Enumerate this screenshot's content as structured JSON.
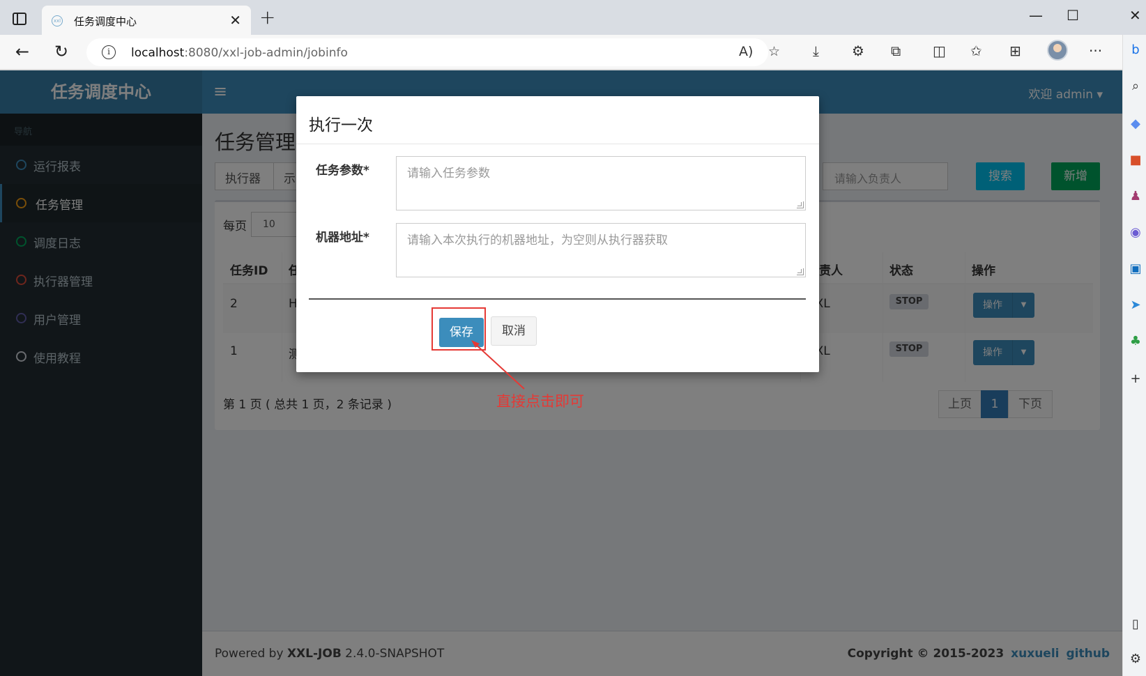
{
  "browser": {
    "tab_title": "任务调度中心",
    "tab_favicon": "xxl",
    "tab_close": "✕",
    "new_tab": "+",
    "url_host": "localhost",
    "url_rest": ":8080/xxl-job-admin/jobinfo",
    "controls": {
      "minimize": "—",
      "maximize": "☐",
      "close": "✕"
    },
    "icons": [
      "read-aloud-icon",
      "favorite-add-icon",
      "downloads-icon",
      "extension-icon",
      "extensions-icon",
      "split-screen-icon",
      "favorites-icon",
      "collections-icon",
      "profile-avatar-icon",
      "more-icon",
      "bing-icon"
    ]
  },
  "app": {
    "logo": "任务调度中心",
    "nav_header": "导航",
    "menu": [
      {
        "label": "运行报表",
        "color": "#3c8dbc"
      },
      {
        "label": "任务管理",
        "color": "#f39c12"
      },
      {
        "label": "调度日志",
        "color": "#00a65a"
      },
      {
        "label": "执行器管理",
        "color": "#dd4b39"
      },
      {
        "label": "用户管理",
        "color": "#605ca8"
      },
      {
        "label": "使用教程",
        "color": "#d2d6de"
      }
    ],
    "welcome": "欢迎 admin ▾"
  },
  "main": {
    "title": "任务管理",
    "filter_executor": "执行器",
    "filter_more": "示",
    "owner_placeholder": "请输入负责人",
    "search_label": "搜索",
    "add_label": "新增",
    "per_page_label": "每页",
    "per_page_value": "10",
    "columns": [
      "任务ID",
      "任",
      "负责人",
      "状态",
      "操作"
    ],
    "rows": [
      {
        "id": "2",
        "desc": "H",
        "owner": "XXL",
        "status": "STOP",
        "op": "操作"
      },
      {
        "id": "1",
        "desc": "测",
        "owner": "XXL",
        "status": "STOP",
        "op": "操作"
      }
    ],
    "page_info": "第 1 页 ( 总共 1 页，2 条记录 )",
    "prev": "上页",
    "page": "1",
    "next": "下页"
  },
  "footer": {
    "powered": "Powered by ",
    "brand": "XXL-JOB",
    "version": " 2.4.0-SNAPSHOT",
    "copyright": "Copyright © 2015-2023",
    "link1": "xuxueli",
    "link2": "github"
  },
  "modal": {
    "title": "执行一次",
    "param_label": "任务参数*",
    "param_placeholder": "请输入任务参数",
    "address_label": "机器地址*",
    "address_placeholder": "请输入本次执行的机器地址，为空则从执行器获取",
    "save_label": "保存",
    "cancel_label": "取消"
  },
  "annotation": {
    "text": "直接点击即可",
    "color": "#e53935"
  }
}
